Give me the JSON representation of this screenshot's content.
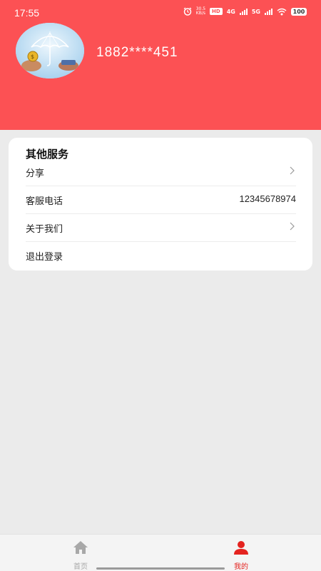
{
  "status_bar": {
    "time": "17:55",
    "net_speed_value": "30.5",
    "net_speed_unit": "KB/s",
    "hd_label": "HD",
    "sim1_label": "4G",
    "sim2_label": "5G",
    "battery": "100"
  },
  "profile": {
    "phone": "1882****451",
    "avatar_icon": "umbrella-money-hands-icon"
  },
  "services": {
    "title": "其他服务",
    "items": [
      {
        "label": "分享",
        "value": "",
        "icon": "chevron-right-icon"
      },
      {
        "label": "客服电话",
        "value": "12345678974",
        "icon": ""
      },
      {
        "label": "关于我们",
        "value": "",
        "icon": "chevron-right-icon"
      },
      {
        "label": "退出登录",
        "value": "",
        "icon": ""
      }
    ]
  },
  "bottom_nav": {
    "items": [
      {
        "label": "首页",
        "icon": "home-icon",
        "active": false
      },
      {
        "label": "我的",
        "icon": "user-icon",
        "active": true
      }
    ]
  },
  "colors": {
    "header_bg": "#fc5154",
    "accent": "#e4231f",
    "page_bg": "#ebebeb",
    "nav_inactive": "#a8a8a8"
  }
}
